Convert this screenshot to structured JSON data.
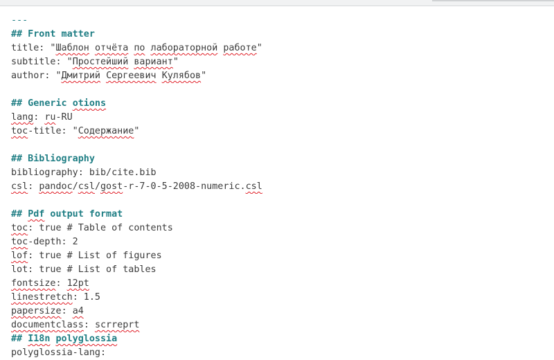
{
  "editor": {
    "lines": [
      {
        "kind": "sep",
        "segments": [
          {
            "text": "---"
          }
        ]
      },
      {
        "kind": "heading",
        "segments": [
          {
            "text": "## Front matter"
          }
        ]
      },
      {
        "kind": "code",
        "segments": [
          {
            "text": "title: \""
          },
          {
            "text": "Шаблон",
            "sp": true
          },
          {
            "text": " "
          },
          {
            "text": "отчёта",
            "sp": true
          },
          {
            "text": " "
          },
          {
            "text": "по",
            "sp": true
          },
          {
            "text": " "
          },
          {
            "text": "лабораторной",
            "sp": true
          },
          {
            "text": " "
          },
          {
            "text": "работе",
            "sp": true
          },
          {
            "text": "\""
          }
        ]
      },
      {
        "kind": "code",
        "segments": [
          {
            "text": "subtitle: \""
          },
          {
            "text": "Простейший",
            "sp": true
          },
          {
            "text": " "
          },
          {
            "text": "вариант",
            "sp": true
          },
          {
            "text": "\""
          }
        ]
      },
      {
        "kind": "code",
        "segments": [
          {
            "text": "author: \""
          },
          {
            "text": "Дмитрий",
            "sp": true
          },
          {
            "text": " "
          },
          {
            "text": "Сергеевич",
            "sp": true
          },
          {
            "text": " "
          },
          {
            "text": "Кулябов",
            "sp": true
          },
          {
            "text": "\""
          }
        ]
      },
      {
        "kind": "blank",
        "segments": [
          {
            "text": ""
          }
        ]
      },
      {
        "kind": "heading",
        "segments": [
          {
            "text": "## Generic "
          },
          {
            "text": "otions",
            "sp": true
          }
        ]
      },
      {
        "kind": "code",
        "segments": [
          {
            "text": "lang",
            "sp": true
          },
          {
            "text": ": "
          },
          {
            "text": "ru",
            "sp": true
          },
          {
            "text": "-RU"
          }
        ]
      },
      {
        "kind": "code",
        "segments": [
          {
            "text": "toc",
            "sp": true
          },
          {
            "text": "-title: \""
          },
          {
            "text": "Содержание",
            "sp": true
          },
          {
            "text": "\""
          }
        ]
      },
      {
        "kind": "blank",
        "segments": [
          {
            "text": ""
          }
        ]
      },
      {
        "kind": "heading",
        "segments": [
          {
            "text": "## Bibliography"
          }
        ]
      },
      {
        "kind": "code",
        "segments": [
          {
            "text": "bibliography: bib/cite.bib"
          }
        ]
      },
      {
        "kind": "code",
        "segments": [
          {
            "text": "csl",
            "sp": true
          },
          {
            "text": ": "
          },
          {
            "text": "pandoc",
            "sp": true
          },
          {
            "text": "/"
          },
          {
            "text": "csl",
            "sp": true
          },
          {
            "text": "/"
          },
          {
            "text": "gost",
            "sp": true
          },
          {
            "text": "-r-7-0-5-2008-numeric."
          },
          {
            "text": "csl",
            "sp": true
          }
        ]
      },
      {
        "kind": "blank",
        "segments": [
          {
            "text": ""
          }
        ]
      },
      {
        "kind": "heading",
        "segments": [
          {
            "text": "## "
          },
          {
            "text": "Pdf",
            "sp": true
          },
          {
            "text": " output format"
          }
        ]
      },
      {
        "kind": "code",
        "segments": [
          {
            "text": "toc",
            "sp": true
          },
          {
            "text": ": true # Table of contents"
          }
        ]
      },
      {
        "kind": "code",
        "segments": [
          {
            "text": "toc",
            "sp": true
          },
          {
            "text": "-depth: 2"
          }
        ]
      },
      {
        "kind": "code",
        "segments": [
          {
            "text": "lof",
            "sp": true
          },
          {
            "text": ": true # List of figures"
          }
        ]
      },
      {
        "kind": "code",
        "segments": [
          {
            "text": "lot: true # List of tables"
          }
        ]
      },
      {
        "kind": "code",
        "segments": [
          {
            "text": "fontsize",
            "sp": true
          },
          {
            "text": ": "
          },
          {
            "text": "12pt",
            "sp": true
          }
        ]
      },
      {
        "kind": "code",
        "segments": [
          {
            "text": "linestretch",
            "sp": true
          },
          {
            "text": ": 1.5"
          }
        ]
      },
      {
        "kind": "code",
        "segments": [
          {
            "text": "papersize",
            "sp": true
          },
          {
            "text": ": "
          },
          {
            "text": "a4",
            "sp": true
          }
        ]
      },
      {
        "kind": "code",
        "segments": [
          {
            "text": "documentclass",
            "sp": true
          },
          {
            "text": ": "
          },
          {
            "text": "scrreprt",
            "sp": true
          }
        ]
      },
      {
        "kind": "heading",
        "segments": [
          {
            "text": "## "
          },
          {
            "text": "I18n",
            "sp": true
          },
          {
            "text": " "
          },
          {
            "text": "polyglossia",
            "sp": true
          }
        ]
      },
      {
        "kind": "code",
        "segments": [
          {
            "text": "polyglossia-lang:"
          }
        ]
      }
    ]
  }
}
